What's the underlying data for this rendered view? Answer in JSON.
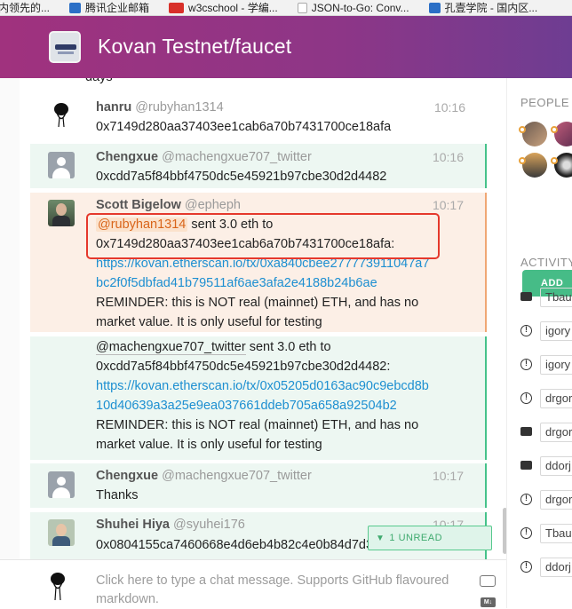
{
  "bookmarks": [
    {
      "label": "内领先的...",
      "color": "#c0392b"
    },
    {
      "label": "腾讯企业邮箱",
      "color": "#2b6fc6"
    },
    {
      "label": "w3cschool - 学编...",
      "color": "#d8302a"
    },
    {
      "label": "JSON-to-Go: Conv...",
      "color": "#9aa0a6"
    },
    {
      "label": "孔壹学院 - 国内区...",
      "color": "#2b6fc6"
    }
  ],
  "header": {
    "title": "Kovan Testnet/faucet"
  },
  "messages": {
    "partial_top": "days",
    "hanru": {
      "name": "hanru",
      "username": "@rubyhan1314",
      "time": "10:16",
      "line1": "0x7149d280aa37403ee1cab6a70b7431700ce18afa"
    },
    "chengxue1": {
      "name": "Chengxue",
      "username": "@machengxue707_twitter",
      "time": "10:16",
      "line1": "0xcdd7a5f84bbf4750dc5e45921b97cbe30d2d4482"
    },
    "scott": {
      "name": "Scott Bigelow",
      "username": "@epheph",
      "time": "10:17",
      "mention": "@rubyhan1314",
      "line1_rest": " sent 3.0 eth to",
      "line2": "0x7149d280aa37403ee1cab6a70b7431700ce18afa:",
      "link1": "https://kovan.etherscan.io/tx/0xa840cbee277773911047a7",
      "link2": "bc2f0f5dbfad41b79511af6ae3afa2e4188b24b6ae",
      "reminder1": "REMINDER: this is NOT real (mainnet) ETH, and has no",
      "reminder2": "market value. It is only useful for testing"
    },
    "scott2": {
      "mention": "@machengxue707_twitter",
      "line1_rest": " sent 3.0 eth to",
      "line2": "0xcdd7a5f84bbf4750dc5e45921b97cbe30d2d4482:",
      "link1": "https://kovan.etherscan.io/tx/0x05205d0163ac90c9ebcd8b",
      "link2": "10d40639a3a25e9ea037661ddeb705a658a92504b2",
      "reminder1": "REMINDER: this is NOT real (mainnet) ETH, and has no",
      "reminder2": "market value. It is only useful for testing"
    },
    "chengxue2": {
      "name": "Chengxue",
      "username": "@machengxue707_twitter",
      "time": "10:17",
      "line1": "Thanks"
    },
    "shuhei": {
      "name": "Shuhei Hiya",
      "username": "@syuhei176",
      "time": "10:17",
      "line1": "0x0804155ca7460668e4d6eb4b82c4e0b84d7d3f79"
    }
  },
  "unread_badge": "1 UNREAD",
  "input": {
    "placeholder": "Click here to type a chat message. Supports GitHub flavoured markdown."
  },
  "md_icon": "M↓",
  "right_panel": {
    "people_title": "PEOPLE",
    "add_label": "ADD",
    "activity_title": "ACTIVITY",
    "activity": [
      {
        "icon": "bubble",
        "text": "Tbau"
      },
      {
        "icon": "bang",
        "text": "igory"
      },
      {
        "icon": "bang",
        "text": "igory"
      },
      {
        "icon": "bang",
        "text": "drgor"
      },
      {
        "icon": "bubble",
        "text": "drgor"
      },
      {
        "icon": "bubble",
        "text": "ddorj"
      },
      {
        "icon": "bang",
        "text": "drgor"
      },
      {
        "icon": "bang",
        "text": "Tbau"
      },
      {
        "icon": "bang",
        "text": "ddorj"
      }
    ]
  },
  "colors": {
    "header_start": "#a0327e",
    "header_end": "#6e3d92",
    "accent_green": "#46bc87",
    "link": "#1d8fd1",
    "highlight_box": "#e5382c"
  }
}
